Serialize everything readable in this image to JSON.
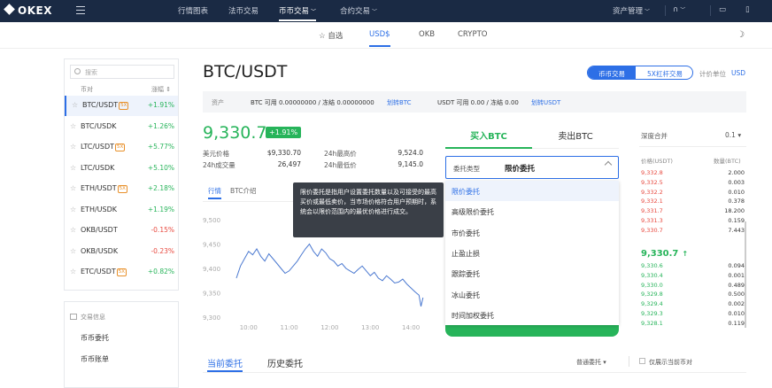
{
  "brand": "OKEX",
  "nav": {
    "items": [
      {
        "label": "行情图表",
        "active": false,
        "caret": false
      },
      {
        "label": "法币交易",
        "active": false,
        "caret": false
      },
      {
        "label": "币币交易",
        "active": true,
        "caret": true
      },
      {
        "label": "合约交易",
        "active": false,
        "caret": true
      }
    ],
    "asset_mgmt": "资产管理"
  },
  "market_tabs": [
    {
      "label": "自选",
      "active": false
    },
    {
      "label": "USD$",
      "active": true
    },
    {
      "label": "OKB",
      "active": false
    },
    {
      "label": "CRYPTO",
      "active": false
    }
  ],
  "sidebar": {
    "search_placeholder": "搜索",
    "col_pair": "币对",
    "col_change": "涨幅 ⇕",
    "coins": [
      {
        "pair": "BTC/USDT",
        "badge": "5X",
        "change": "+1.91%",
        "dir": "up",
        "selected": true
      },
      {
        "pair": "BTC/USDK",
        "badge": "",
        "change": "+1.26%",
        "dir": "up",
        "selected": false
      },
      {
        "pair": "LTC/USDT",
        "badge": "5X",
        "change": "+5.77%",
        "dir": "up",
        "selected": false
      },
      {
        "pair": "LTC/USDK",
        "badge": "",
        "change": "+5.10%",
        "dir": "up",
        "selected": false
      },
      {
        "pair": "ETH/USDT",
        "badge": "5X",
        "change": "+2.18%",
        "dir": "up",
        "selected": false
      },
      {
        "pair": "ETH/USDK",
        "badge": "",
        "change": "+1.19%",
        "dir": "up",
        "selected": false
      },
      {
        "pair": "OKB/USDT",
        "badge": "",
        "change": "-0.15%",
        "dir": "dn",
        "selected": false
      },
      {
        "pair": "OKB/USDK",
        "badge": "",
        "change": "-0.23%",
        "dir": "dn",
        "selected": false
      },
      {
        "pair": "ETC/USDT",
        "badge": "5X",
        "change": "+0.82%",
        "dir": "up",
        "selected": false
      }
    ]
  },
  "info": {
    "header": "交易信息",
    "items": [
      "币币委托",
      "币币账单"
    ]
  },
  "pair_title": "BTC/USDT",
  "mode_toggle": {
    "spot": "币币交易",
    "margin": "5X杠杆交易"
  },
  "unit": {
    "label": "计价单位",
    "value": "USD"
  },
  "assets": {
    "label": "资产",
    "btc_text": "BTC  可用 0.00000000 / 冻结 0.00000000",
    "btc_link": "划转BTC",
    "usdt_text": "USDT  可用 0.00 / 冻结 0.00",
    "usdt_link": "划转USDT"
  },
  "ticker": {
    "price": "9,330.7",
    "change": "+1.91%",
    "usd_label": "美元价格",
    "usd_value": "$9,330.70",
    "high_label": "24h最高价",
    "high_value": "9,524.0",
    "vol_label": "24h成交量",
    "vol_value": "26,497",
    "low_label": "24h最低价",
    "low_value": "9,145.0"
  },
  "chart_tabs": {
    "market": "行情",
    "intro": "BTC介绍"
  },
  "chart_data": {
    "type": "line",
    "y_ticks": [
      "9,500",
      "9,450",
      "9,400",
      "9,350",
      "9,300"
    ],
    "x_ticks": [
      "10:00",
      "11:00",
      "12:00",
      "13:00",
      "14:00"
    ],
    "ylim": [
      9300,
      9500
    ],
    "xlim": [
      9.35,
      14.5
    ],
    "series": [
      {
        "x": [
          9.7,
          9.8,
          9.9,
          10.0,
          10.1,
          10.2,
          10.3,
          10.4,
          10.5,
          10.6,
          10.7,
          10.8,
          10.9,
          11.0,
          11.1,
          11.2,
          11.3,
          11.4,
          11.5,
          11.6,
          11.7,
          11.8,
          11.9,
          12.0,
          12.1,
          12.2,
          12.3,
          12.4,
          12.5,
          12.6,
          12.7,
          12.8,
          12.9,
          13.0,
          13.1,
          13.2,
          13.3,
          13.4,
          13.5,
          13.6,
          13.7,
          13.8,
          13.9,
          14.0,
          14.1,
          14.2,
          14.25,
          14.3
        ],
        "y": [
          9380,
          9405,
          9420,
          9435,
          9428,
          9440,
          9425,
          9415,
          9430,
          9420,
          9410,
          9400,
          9390,
          9395,
          9405,
          9415,
          9428,
          9440,
          9450,
          9435,
          9425,
          9440,
          9432,
          9420,
          9415,
          9405,
          9410,
          9400,
          9395,
          9390,
          9398,
          9405,
          9395,
          9385,
          9392,
          9380,
          9375,
          9385,
          9378,
          9370,
          9372,
          9378,
          9368,
          9360,
          9352,
          9345,
          9322,
          9340
        ]
      }
    ]
  },
  "tooltip": "限价委托是指用户设置委托数量以及可接受的最高买价或最低卖价，当市场价格符合用户预期时，系统会以限价范围内的最优价格进行成交。",
  "trade": {
    "buy_tab": "买入BTC",
    "sell_tab": "卖出BTC",
    "type_label": "委托类型",
    "type_value": "限价委托",
    "options": [
      "限价委托",
      "高级限价委托",
      "市价委托",
      "止盈止损",
      "跟踪委托",
      "冰山委托",
      "时间加权委托"
    ]
  },
  "orderbook": {
    "title": "深度合并",
    "precision": "0.1",
    "col_price": "价格(USDT)",
    "col_qty": "数量(BTC)",
    "asks": [
      {
        "p": "9,332.8",
        "q": "2.000"
      },
      {
        "p": "9,332.5",
        "q": "0.003"
      },
      {
        "p": "9,332.2",
        "q": "0.010"
      },
      {
        "p": "9,332.1",
        "q": "0.378"
      },
      {
        "p": "9,331.7",
        "q": "18.200"
      },
      {
        "p": "9,331.3",
        "q": "0.159"
      },
      {
        "p": "9,330.7",
        "q": "7.443"
      }
    ],
    "mid": "9,330.7",
    "mid_arrow": "↑",
    "bids": [
      {
        "p": "9,330.6",
        "q": "0.094"
      },
      {
        "p": "9,330.4",
        "q": "0.001"
      },
      {
        "p": "9,330.0",
        "q": "0.489"
      },
      {
        "p": "9,329.8",
        "q": "0.500"
      },
      {
        "p": "9,329.4",
        "q": "0.002"
      },
      {
        "p": "9,329.3",
        "q": "0.010"
      },
      {
        "p": "9,328.1",
        "q": "0.119"
      }
    ]
  },
  "orders": {
    "current": "当前委托",
    "history": "历史委托",
    "type": "普通委托",
    "only_current": "仅展示当前币对"
  }
}
